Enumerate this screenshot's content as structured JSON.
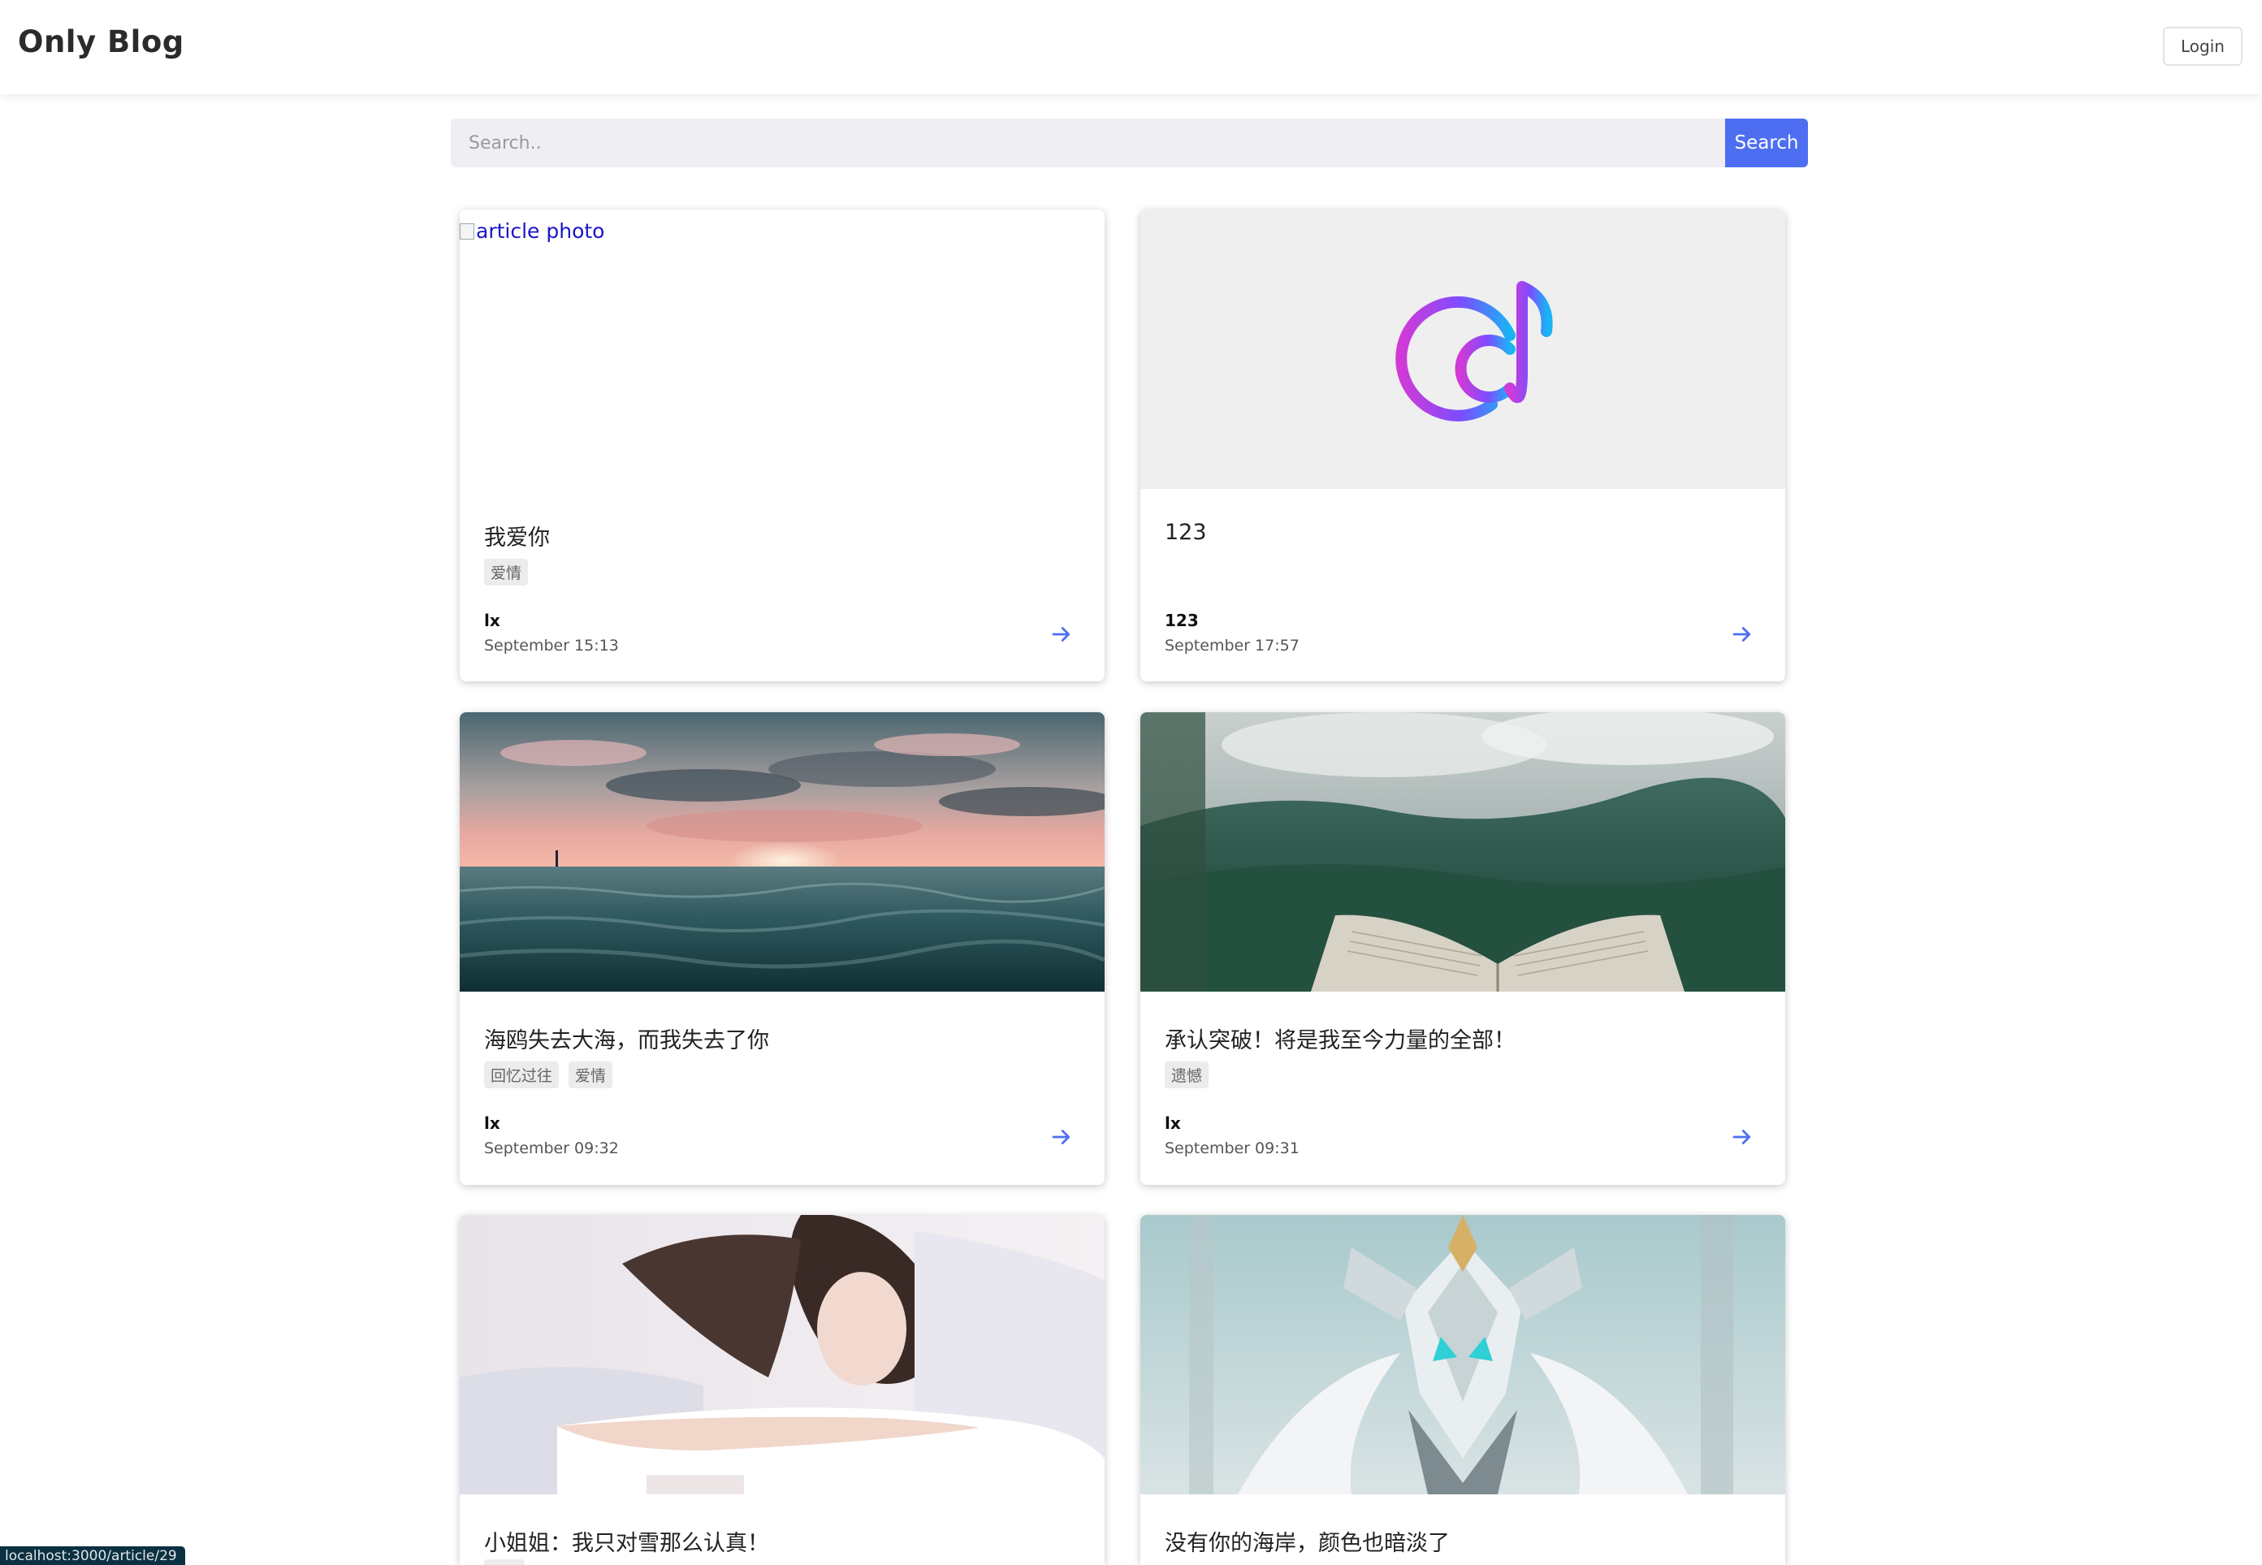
{
  "header": {
    "brand": "Only Blog",
    "login_label": "Login"
  },
  "search": {
    "placeholder": "Search..",
    "value": "",
    "button_label": "Search",
    "accent_color": "#4e6ef2"
  },
  "articles": [
    {
      "title": "我爱你",
      "tags": [
        "爱情"
      ],
      "author": "lx",
      "date": "September 15:13",
      "image_alt": "article photo",
      "image": "broken-image"
    },
    {
      "title": "123",
      "tags": [],
      "author": "123",
      "date": "September 17:57",
      "image": "music-note-logo"
    },
    {
      "title": "海鸥失去大海，而我失去了你",
      "tags": [
        "回忆过往",
        "爱情"
      ],
      "author": "lx",
      "date": "September 09:32",
      "image": "ocean-sunset-photo"
    },
    {
      "title": "承认突破！将是我至今力量的全部！",
      "tags": [
        "遗憾"
      ],
      "author": "lx",
      "date": "September 09:31",
      "image": "forest-book-photo"
    },
    {
      "title": "小姐姐：我只对雪那么认真！",
      "tags": [
        ""
      ],
      "image": "girl-in-bed-photo"
    },
    {
      "title": "没有你的海岸，颜色也暗淡了",
      "tags": [],
      "image": "white-mecha-photo"
    }
  ],
  "status_bar": {
    "url": "localhost:3000/article/29"
  }
}
